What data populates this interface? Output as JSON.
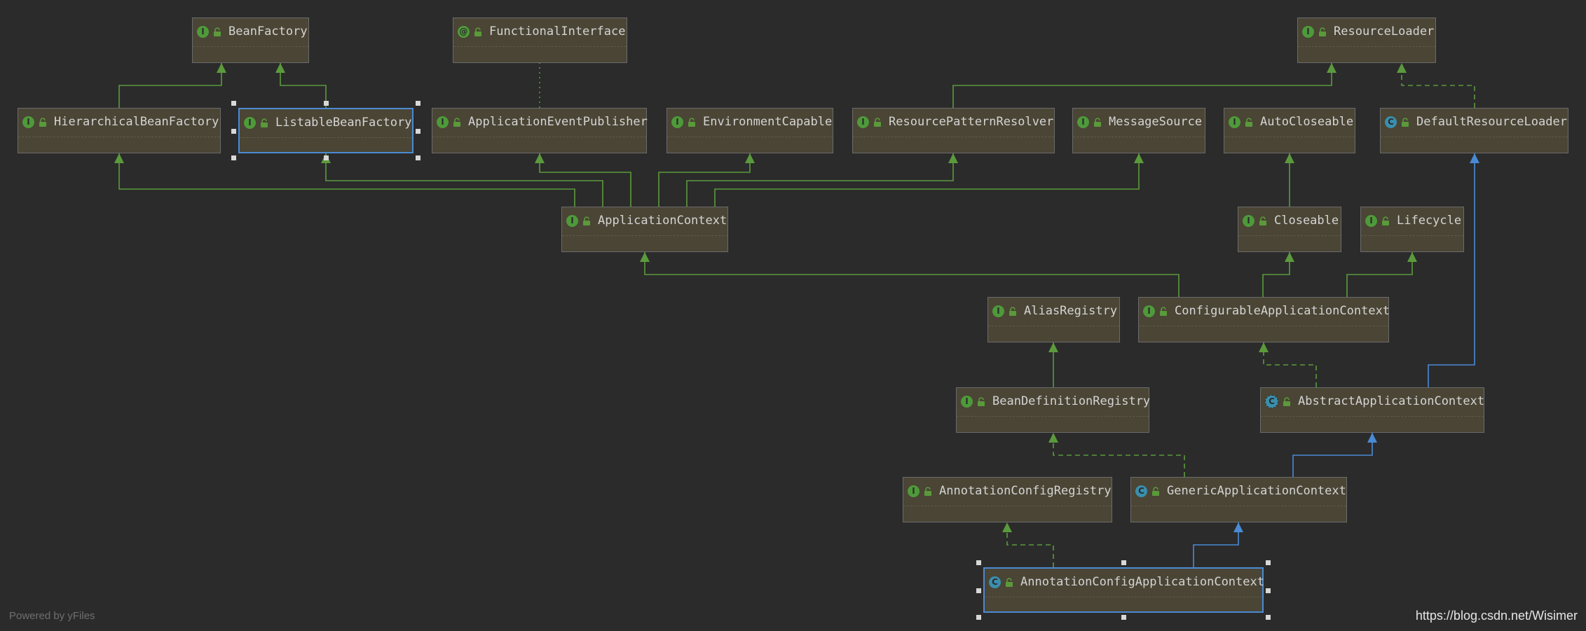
{
  "colors": {
    "background": "#2b2b2b",
    "node_fill": "#4a4535",
    "node_border": "#6b6b6b",
    "selected_border": "#4a8ad4",
    "interface_badge": "#4e9a3a",
    "class_badge": "#3a8fae",
    "annotation_badge": "#4e9a3a",
    "edge_interface": "#5b9a3c",
    "edge_class": "#4a8ad4",
    "label": "#d4d4d4"
  },
  "nodes": [
    {
      "id": "BeanFactory",
      "label": "BeanFactory",
      "kind": "interface",
      "selected": false
    },
    {
      "id": "FunctionalInterface",
      "label": "FunctionalInterface",
      "kind": "annotation",
      "selected": false
    },
    {
      "id": "ResourceLoader",
      "label": "ResourceLoader",
      "kind": "interface",
      "selected": false
    },
    {
      "id": "HierarchicalBeanFactory",
      "label": "HierarchicalBeanFactory",
      "kind": "interface",
      "selected": false
    },
    {
      "id": "ListableBeanFactory",
      "label": "ListableBeanFactory",
      "kind": "interface",
      "selected": true
    },
    {
      "id": "ApplicationEventPublisher",
      "label": "ApplicationEventPublisher",
      "kind": "interface",
      "selected": false
    },
    {
      "id": "EnvironmentCapable",
      "label": "EnvironmentCapable",
      "kind": "interface",
      "selected": false
    },
    {
      "id": "ResourcePatternResolver",
      "label": "ResourcePatternResolver",
      "kind": "interface",
      "selected": false
    },
    {
      "id": "MessageSource",
      "label": "MessageSource",
      "kind": "interface",
      "selected": false
    },
    {
      "id": "AutoCloseable",
      "label": "AutoCloseable",
      "kind": "interface",
      "selected": false
    },
    {
      "id": "DefaultResourceLoader",
      "label": "DefaultResourceLoader",
      "kind": "class",
      "selected": false
    },
    {
      "id": "ApplicationContext",
      "label": "ApplicationContext",
      "kind": "interface",
      "selected": false
    },
    {
      "id": "Closeable",
      "label": "Closeable",
      "kind": "interface",
      "selected": false
    },
    {
      "id": "Lifecycle",
      "label": "Lifecycle",
      "kind": "interface",
      "selected": false
    },
    {
      "id": "AliasRegistry",
      "label": "AliasRegistry",
      "kind": "interface",
      "selected": false
    },
    {
      "id": "ConfigurableApplicationContext",
      "label": "ConfigurableApplicationContext",
      "kind": "interface",
      "selected": false
    },
    {
      "id": "BeanDefinitionRegistry",
      "label": "BeanDefinitionRegistry",
      "kind": "interface",
      "selected": false
    },
    {
      "id": "AbstractApplicationContext",
      "label": "AbstractApplicationContext",
      "kind": "abstract",
      "selected": false
    },
    {
      "id": "AnnotationConfigRegistry",
      "label": "AnnotationConfigRegistry",
      "kind": "interface",
      "selected": false
    },
    {
      "id": "GenericApplicationContext",
      "label": "GenericApplicationContext",
      "kind": "class",
      "selected": false
    },
    {
      "id": "AnnotationConfigApplicationContext",
      "label": "AnnotationConfigApplicationContext",
      "kind": "class",
      "selected": true
    }
  ],
  "edges": [
    {
      "from": "HierarchicalBeanFactory",
      "to": "BeanFactory",
      "type": "extends"
    },
    {
      "from": "ListableBeanFactory",
      "to": "BeanFactory",
      "type": "extends"
    },
    {
      "from": "ApplicationEventPublisher",
      "to": "FunctionalInterface",
      "type": "annotated"
    },
    {
      "from": "ResourcePatternResolver",
      "to": "ResourceLoader",
      "type": "extends"
    },
    {
      "from": "DefaultResourceLoader",
      "to": "ResourceLoader",
      "type": "implements"
    },
    {
      "from": "ApplicationContext",
      "to": "HierarchicalBeanFactory",
      "type": "extends"
    },
    {
      "from": "ApplicationContext",
      "to": "ListableBeanFactory",
      "type": "extends"
    },
    {
      "from": "ApplicationContext",
      "to": "ApplicationEventPublisher",
      "type": "extends"
    },
    {
      "from": "ApplicationContext",
      "to": "EnvironmentCapable",
      "type": "extends"
    },
    {
      "from": "ApplicationContext",
      "to": "ResourcePatternResolver",
      "type": "extends"
    },
    {
      "from": "ApplicationContext",
      "to": "MessageSource",
      "type": "extends"
    },
    {
      "from": "Closeable",
      "to": "AutoCloseable",
      "type": "extends"
    },
    {
      "from": "ConfigurableApplicationContext",
      "to": "ApplicationContext",
      "type": "extends"
    },
    {
      "from": "ConfigurableApplicationContext",
      "to": "Closeable",
      "type": "extends"
    },
    {
      "from": "ConfigurableApplicationContext",
      "to": "Lifecycle",
      "type": "extends"
    },
    {
      "from": "BeanDefinitionRegistry",
      "to": "AliasRegistry",
      "type": "extends"
    },
    {
      "from": "AbstractApplicationContext",
      "to": "ConfigurableApplicationContext",
      "type": "implements"
    },
    {
      "from": "AbstractApplicationContext",
      "to": "DefaultResourceLoader",
      "type": "class-extends"
    },
    {
      "from": "GenericApplicationContext",
      "to": "BeanDefinitionRegistry",
      "type": "implements"
    },
    {
      "from": "GenericApplicationContext",
      "to": "AbstractApplicationContext",
      "type": "class-extends"
    },
    {
      "from": "AnnotationConfigApplicationContext",
      "to": "AnnotationConfigRegistry",
      "type": "implements"
    },
    {
      "from": "AnnotationConfigApplicationContext",
      "to": "GenericApplicationContext",
      "type": "class-extends"
    }
  ],
  "footer": {
    "powered_by": "Powered by yFiles",
    "watermark": "https://blog.csdn.net/Wisimer"
  }
}
